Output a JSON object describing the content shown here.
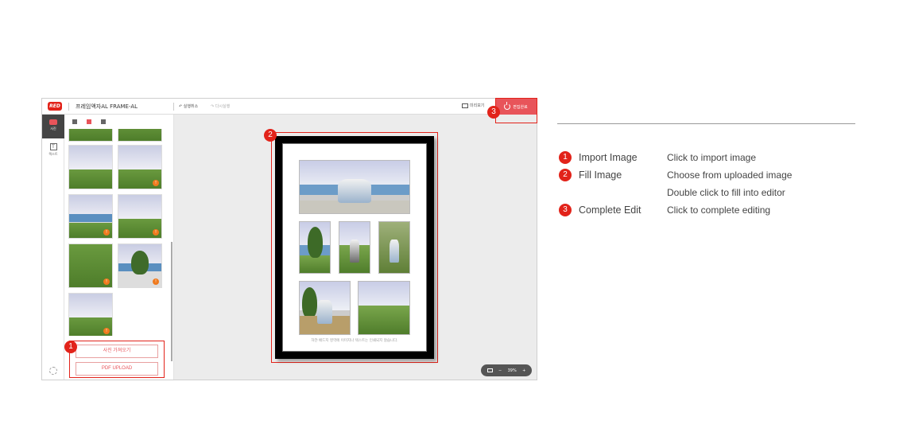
{
  "app": {
    "logo_text": "RED",
    "product_title": "프레임액자AL FRAME-AL",
    "undo_label": "실행취소",
    "redo_label": "다시실행",
    "preview_label": "미리보기",
    "done_label": "편집완료",
    "rail": {
      "photo_label": "사진",
      "text_label": "텍스트"
    },
    "panel": {
      "import_button": "사진 가져오기",
      "pdf_button": "PDF UPLOAD"
    },
    "canvas": {
      "caption": "하얀 배드지 영역에 이미지나 텍스트는 인쇄되지 않습니다.",
      "zoom_value": "39%",
      "zoom_minus": "−",
      "zoom_plus": "+"
    }
  },
  "callouts": {
    "one": "1",
    "two": "2",
    "three": "3"
  },
  "legend": [
    {
      "num": "1",
      "label": "Import Image",
      "desc": "Click to import image"
    },
    {
      "num": "2",
      "label": "Fill Image",
      "desc": "Choose from uploaded image"
    },
    {
      "num": "",
      "label": "",
      "desc": "Double click to fill into editor"
    },
    {
      "num": "3",
      "label": "Complete Edit",
      "desc": "Click to complete editing"
    }
  ],
  "colors": {
    "accent": "#e2231a",
    "button": "#e8545a",
    "warn": "#f07a1e"
  }
}
